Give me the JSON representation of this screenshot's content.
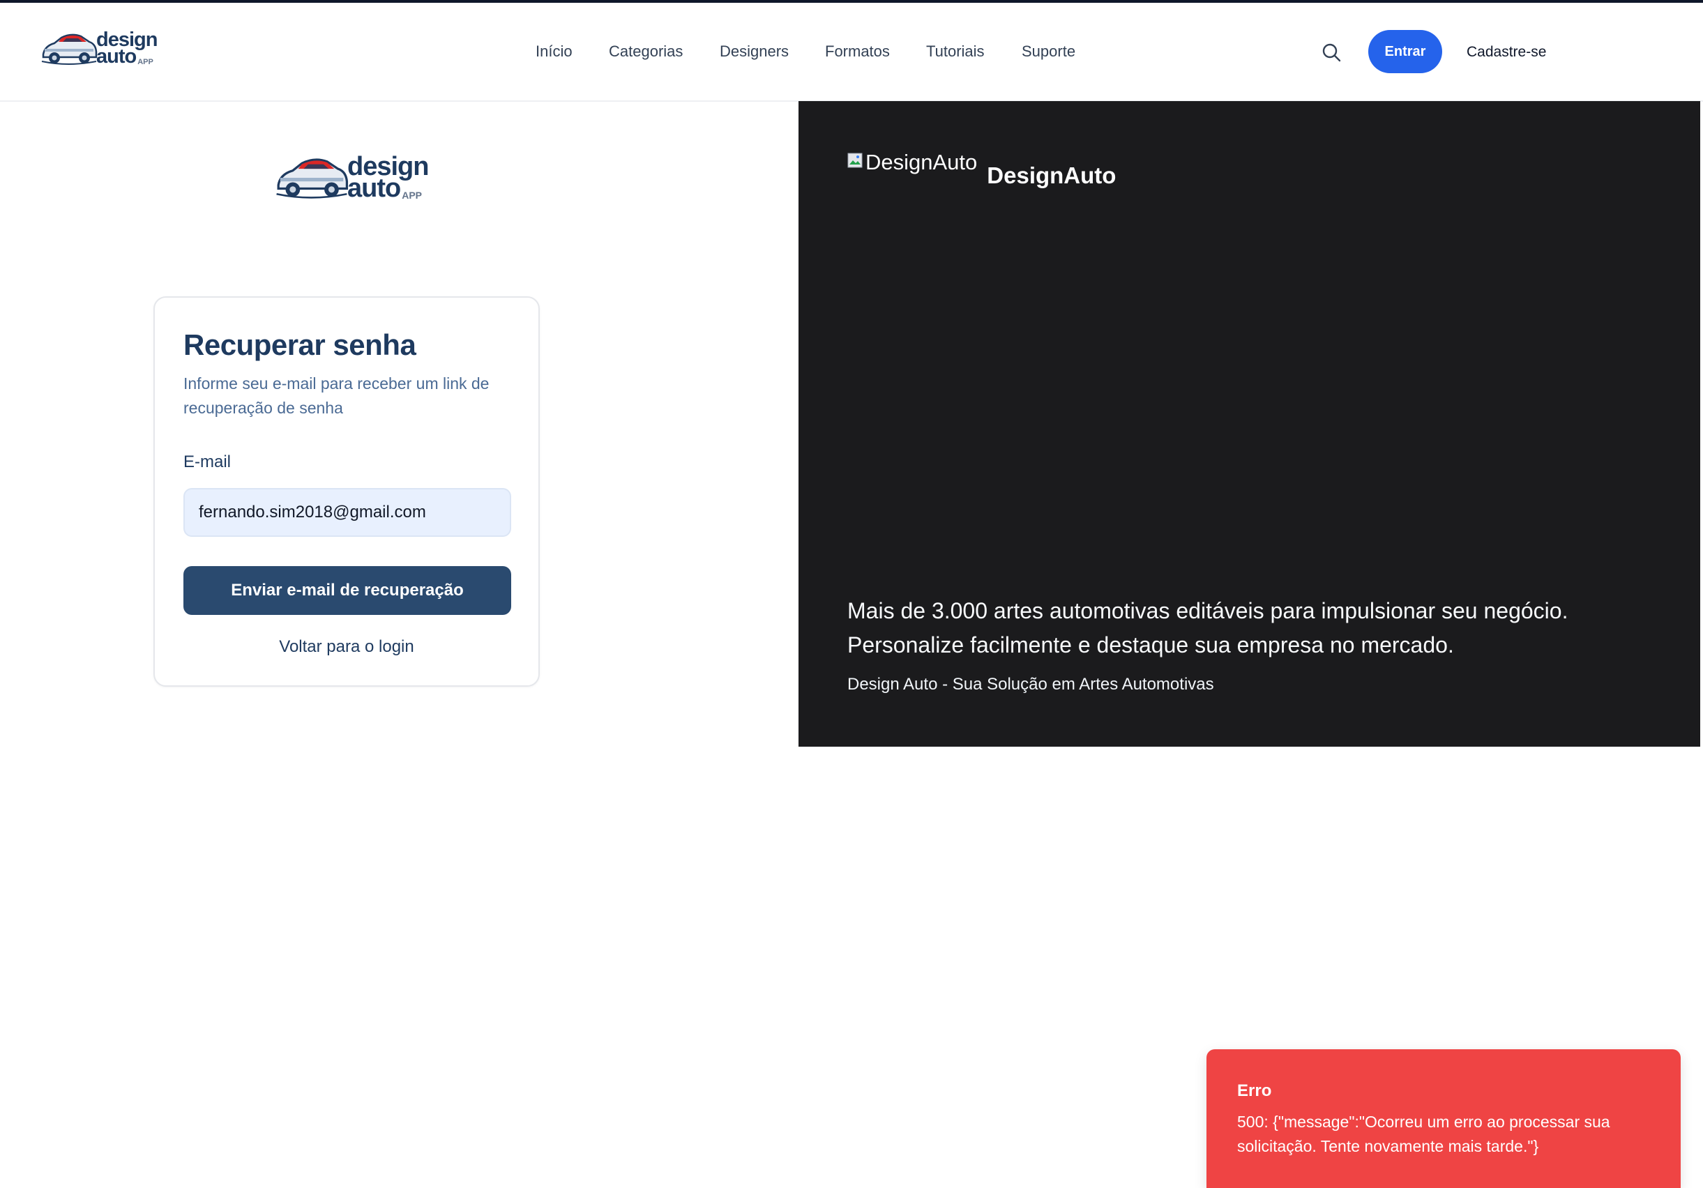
{
  "brand": {
    "logo_word1": "design",
    "logo_word2": "auto",
    "logo_suffix": "APP",
    "primary_color": "#2563eb",
    "dark_blue": "#1e3a5f",
    "logo_red": "#dc2626"
  },
  "header": {
    "nav": [
      "Início",
      "Categorias",
      "Designers",
      "Formatos",
      "Tutoriais",
      "Suporte"
    ],
    "search_icon": "search-icon",
    "login_label": "Entrar",
    "signup_label": "Cadastre-se"
  },
  "recover": {
    "title": "Recuperar senha",
    "description": "Informe seu e-mail para receber um link de recuperação de senha",
    "email_label": "E-mail",
    "email_value": "fernando.sim2018@gmail.com",
    "submit_label": "Enviar e-mail de recuperação",
    "back_label": "Voltar para o login"
  },
  "hero": {
    "image_alt": "DesignAuto",
    "brand_name": "DesignAuto",
    "text_line1": "Mais de 3.000 artes automotivas editáveis para impulsionar seu negócio.",
    "text_line2": "Personalize facilmente e destaque sua empresa no mercado.",
    "tagline": "Design Auto - Sua Solução em Artes Automotivas",
    "background": "#1b1b1d"
  },
  "toast": {
    "title": "Erro",
    "message": "500: {\"message\":\"Ocorreu um erro ao processar sua solicitação. Tente novamente mais tarde.\"}",
    "color": "#ef4444"
  }
}
